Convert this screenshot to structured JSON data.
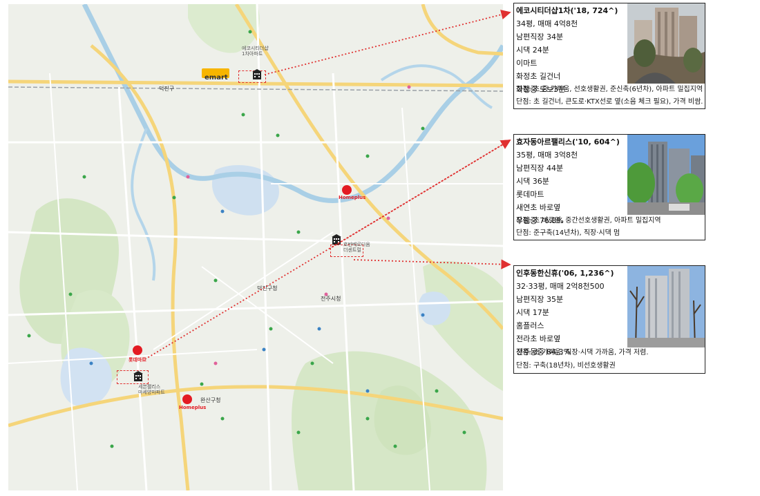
{
  "map": {
    "district_labels": [
      "덕진구",
      "완산구청",
      "덕진구청",
      "전주시청"
    ],
    "brands": {
      "emart": "emart",
      "homeplus": "Homeplus",
      "lotte": "롯데마트"
    },
    "poi_labels": {
      "eco": "에코시티더샵\n1차아파트",
      "hyoja": "호반베르디움\n더센트럴",
      "inhu": "세븐팰리스\n마세양마파트"
    }
  },
  "apartments": [
    {
      "title": "에코시티더샵1차('18, 724^)",
      "lines": [
        "34평, 매매 4억8천",
        "남편직장 34분",
        "시댁 24분",
        "이마트",
        "화정초 길건너",
        "화정중 도보3분"
      ],
      "pros": "장점: 초·중 가까움, 선호생활권, 준신축(6년차), 아파트 밀집지역",
      "cons": "단점: 초 길건너, 큰도로·KTX선로 옆(소음 체크 필요), 가격 비쌈."
    },
    {
      "title": "효자동아르팰리스('10, 604^)",
      "lines": [
        "35평, 매매 3억8천",
        "남편직장 44분",
        "시댁 36분",
        "롯데마트",
        "새연초 바로옆",
        "우림중 76.8%"
      ],
      "pros": "장점: 초 바로옆, 중간선호생활권, 아파트 밀집지역",
      "cons": "단점: 준구축(14년차), 직장·시댁 멈"
    },
    {
      "title": "인후동한신휴('06, 1,236^)",
      "lines": [
        "32·33평, 매매 2억8천500",
        "남편직장 35분",
        "시댁 17분",
        "홈플러스",
        "전라초 바로옆",
        "전주동중 84.3%"
      ],
      "pros": "장점: 초 가까움, 직장·시댁 가까움, 가격 저렴.",
      "cons": "단점: 구축(18년차), 비선호생활권"
    }
  ]
}
